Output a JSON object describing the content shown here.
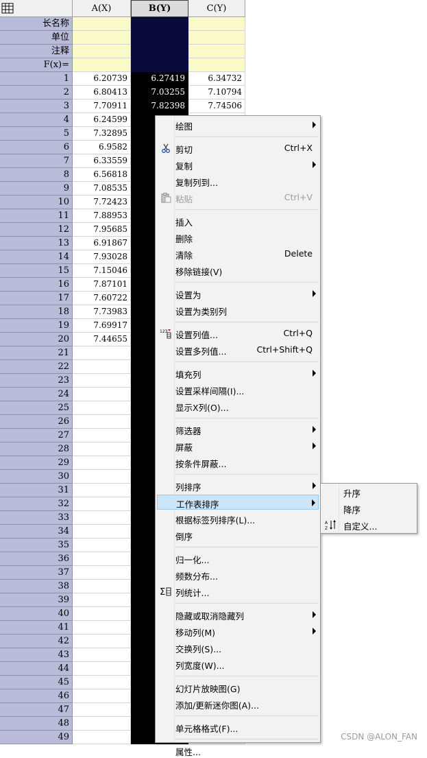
{
  "columns": {
    "a": "A(X)",
    "b": "B(Y)",
    "c": "C(Y)"
  },
  "meta_rows": [
    "长名称",
    "单位",
    "注释",
    "F(x)="
  ],
  "rows": [
    {
      "n": "1",
      "a": "6.20739",
      "b": "6.27419",
      "c": "6.34732"
    },
    {
      "n": "2",
      "a": "6.80413",
      "b": "7.03255",
      "c": "7.10794"
    },
    {
      "n": "3",
      "a": "7.70911",
      "b": "7.82398",
      "c": "7.74506"
    },
    {
      "n": "4",
      "a": "6.24599",
      "b": "",
      "c": ""
    },
    {
      "n": "5",
      "a": "7.32895",
      "b": "",
      "c": ""
    },
    {
      "n": "6",
      "a": "6.9582",
      "b": "",
      "c": ""
    },
    {
      "n": "7",
      "a": "6.33559",
      "b": "",
      "c": ""
    },
    {
      "n": "8",
      "a": "6.56818",
      "b": "",
      "c": ""
    },
    {
      "n": "9",
      "a": "7.08535",
      "b": "",
      "c": ""
    },
    {
      "n": "10",
      "a": "7.72423",
      "b": "",
      "c": ""
    },
    {
      "n": "11",
      "a": "7.88953",
      "b": "",
      "c": ""
    },
    {
      "n": "12",
      "a": "7.95685",
      "b": "",
      "c": ""
    },
    {
      "n": "13",
      "a": "6.91867",
      "b": "",
      "c": ""
    },
    {
      "n": "14",
      "a": "7.93028",
      "b": "",
      "c": ""
    },
    {
      "n": "15",
      "a": "7.15046",
      "b": "",
      "c": ""
    },
    {
      "n": "16",
      "a": "7.87101",
      "b": "",
      "c": ""
    },
    {
      "n": "17",
      "a": "7.60722",
      "b": "",
      "c": ""
    },
    {
      "n": "18",
      "a": "7.73983",
      "b": "",
      "c": ""
    },
    {
      "n": "19",
      "a": "7.69917",
      "b": "",
      "c": ""
    },
    {
      "n": "20",
      "a": "7.44655",
      "b": "",
      "c": ""
    },
    {
      "n": "21",
      "a": "",
      "b": "",
      "c": ""
    },
    {
      "n": "22",
      "a": "",
      "b": "",
      "c": ""
    },
    {
      "n": "23",
      "a": "",
      "b": "",
      "c": ""
    },
    {
      "n": "24",
      "a": "",
      "b": "",
      "c": ""
    },
    {
      "n": "25",
      "a": "",
      "b": "",
      "c": ""
    },
    {
      "n": "26",
      "a": "",
      "b": "",
      "c": ""
    },
    {
      "n": "27",
      "a": "",
      "b": "",
      "c": ""
    },
    {
      "n": "28",
      "a": "",
      "b": "",
      "c": ""
    },
    {
      "n": "29",
      "a": "",
      "b": "",
      "c": ""
    },
    {
      "n": "30",
      "a": "",
      "b": "",
      "c": ""
    },
    {
      "n": "31",
      "a": "",
      "b": "",
      "c": ""
    },
    {
      "n": "32",
      "a": "",
      "b": "",
      "c": ""
    },
    {
      "n": "33",
      "a": "",
      "b": "",
      "c": ""
    },
    {
      "n": "34",
      "a": "",
      "b": "",
      "c": ""
    },
    {
      "n": "35",
      "a": "",
      "b": "",
      "c": ""
    },
    {
      "n": "36",
      "a": "",
      "b": "",
      "c": ""
    },
    {
      "n": "37",
      "a": "",
      "b": "",
      "c": ""
    },
    {
      "n": "38",
      "a": "",
      "b": "",
      "c": ""
    },
    {
      "n": "39",
      "a": "",
      "b": "",
      "c": ""
    },
    {
      "n": "40",
      "a": "",
      "b": "",
      "c": ""
    },
    {
      "n": "41",
      "a": "",
      "b": "",
      "c": ""
    },
    {
      "n": "42",
      "a": "",
      "b": "",
      "c": ""
    },
    {
      "n": "43",
      "a": "",
      "b": "",
      "c": ""
    },
    {
      "n": "44",
      "a": "",
      "b": "",
      "c": ""
    },
    {
      "n": "45",
      "a": "",
      "b": "",
      "c": ""
    },
    {
      "n": "46",
      "a": "",
      "b": "",
      "c": ""
    },
    {
      "n": "47",
      "a": "",
      "b": "",
      "c": ""
    },
    {
      "n": "48",
      "a": "",
      "b": "",
      "c": ""
    },
    {
      "n": "49",
      "a": "",
      "b": "",
      "c": ""
    }
  ],
  "context_menu": [
    {
      "label": "绘图",
      "shortcut": "",
      "submenu": true,
      "disabled": false,
      "icon": ""
    },
    {
      "sep": true
    },
    {
      "label": "剪切",
      "shortcut": "Ctrl+X",
      "submenu": false,
      "disabled": false,
      "icon": "scissors-icon"
    },
    {
      "label": "复制",
      "shortcut": "",
      "submenu": true,
      "disabled": false,
      "icon": ""
    },
    {
      "label": "复制列到...",
      "shortcut": "",
      "submenu": false,
      "disabled": false,
      "icon": ""
    },
    {
      "label": "粘贴",
      "shortcut": "Ctrl+V",
      "submenu": false,
      "disabled": true,
      "icon": "paste-icon"
    },
    {
      "sep": true
    },
    {
      "label": "插入",
      "shortcut": "",
      "submenu": false,
      "disabled": false,
      "icon": ""
    },
    {
      "label": "删除",
      "shortcut": "",
      "submenu": false,
      "disabled": false,
      "icon": ""
    },
    {
      "label": "清除",
      "shortcut": "Delete",
      "submenu": false,
      "disabled": false,
      "icon": ""
    },
    {
      "label": "移除链接(V)",
      "shortcut": "",
      "submenu": false,
      "disabled": false,
      "icon": ""
    },
    {
      "sep": true
    },
    {
      "label": "设置为",
      "shortcut": "",
      "submenu": true,
      "disabled": false,
      "icon": ""
    },
    {
      "label": "设置为类别列",
      "shortcut": "",
      "submenu": false,
      "disabled": false,
      "icon": ""
    },
    {
      "sep": true
    },
    {
      "label": "设置列值...",
      "shortcut": "Ctrl+Q",
      "submenu": false,
      "disabled": false,
      "icon": "set-values-icon"
    },
    {
      "label": "设置多列值...",
      "shortcut": "Ctrl+Shift+Q",
      "submenu": false,
      "disabled": false,
      "icon": ""
    },
    {
      "sep": true
    },
    {
      "label": "填充列",
      "shortcut": "",
      "submenu": true,
      "disabled": false,
      "icon": ""
    },
    {
      "label": "设置采样间隔(I)...",
      "shortcut": "",
      "submenu": false,
      "disabled": false,
      "icon": ""
    },
    {
      "label": "显示X列(O)...",
      "shortcut": "",
      "submenu": false,
      "disabled": false,
      "icon": ""
    },
    {
      "sep": true
    },
    {
      "label": "筛选器",
      "shortcut": "",
      "submenu": true,
      "disabled": false,
      "icon": ""
    },
    {
      "label": "屏蔽",
      "shortcut": "",
      "submenu": true,
      "disabled": false,
      "icon": ""
    },
    {
      "label": "按条件屏蔽...",
      "shortcut": "",
      "submenu": false,
      "disabled": false,
      "icon": ""
    },
    {
      "sep": true
    },
    {
      "label": "列排序",
      "shortcut": "",
      "submenu": true,
      "disabled": false,
      "icon": ""
    },
    {
      "label": "工作表排序",
      "shortcut": "",
      "submenu": true,
      "disabled": false,
      "icon": "",
      "highlight": true
    },
    {
      "label": "根据标签列排序(L)...",
      "shortcut": "",
      "submenu": false,
      "disabled": false,
      "icon": ""
    },
    {
      "label": "倒序",
      "shortcut": "",
      "submenu": false,
      "disabled": false,
      "icon": ""
    },
    {
      "sep": true
    },
    {
      "label": "归一化...",
      "shortcut": "",
      "submenu": false,
      "disabled": false,
      "icon": ""
    },
    {
      "label": "频数分布...",
      "shortcut": "",
      "submenu": false,
      "disabled": false,
      "icon": ""
    },
    {
      "label": "列统计...",
      "shortcut": "",
      "submenu": false,
      "disabled": false,
      "icon": "sigma-icon"
    },
    {
      "sep": true
    },
    {
      "label": "隐藏或取消隐藏列",
      "shortcut": "",
      "submenu": true,
      "disabled": false,
      "icon": ""
    },
    {
      "label": "移动列(M)",
      "shortcut": "",
      "submenu": true,
      "disabled": false,
      "icon": ""
    },
    {
      "label": "交换列(S)...",
      "shortcut": "",
      "submenu": false,
      "disabled": false,
      "icon": ""
    },
    {
      "label": "列宽度(W)...",
      "shortcut": "",
      "submenu": false,
      "disabled": false,
      "icon": ""
    },
    {
      "sep": true
    },
    {
      "label": "幻灯片放映图(G)",
      "shortcut": "",
      "submenu": false,
      "disabled": false,
      "icon": ""
    },
    {
      "label": "添加/更新迷你图(A)...",
      "shortcut": "",
      "submenu": false,
      "disabled": false,
      "icon": ""
    },
    {
      "sep": true
    },
    {
      "label": "单元格格式(F)...",
      "shortcut": "",
      "submenu": false,
      "disabled": false,
      "icon": ""
    },
    {
      "sep": true
    },
    {
      "label": "属性...",
      "shortcut": "",
      "submenu": false,
      "disabled": false,
      "icon": ""
    }
  ],
  "sort_submenu": [
    {
      "label": "升序",
      "icon": ""
    },
    {
      "label": "降序",
      "icon": ""
    },
    {
      "label": "自定义...",
      "icon": "custom-sort-icon"
    }
  ],
  "watermark": "CSDN @ALON_FAN"
}
